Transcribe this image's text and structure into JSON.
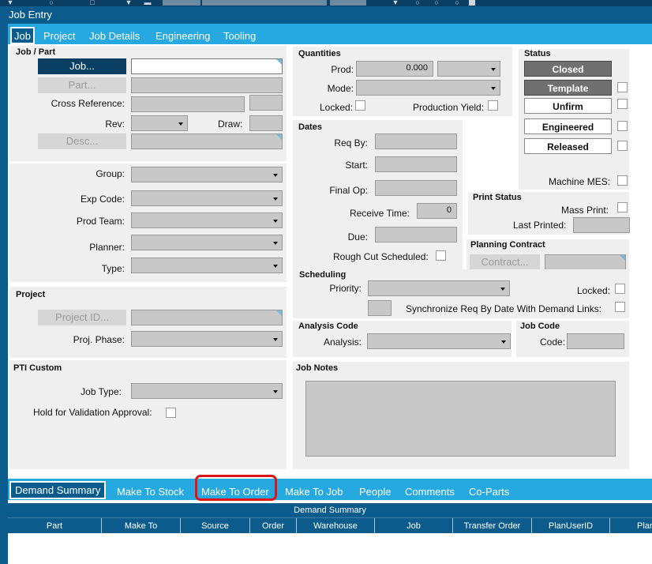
{
  "window": {
    "title": "Job Entry"
  },
  "tabs": [
    "Job",
    "Project",
    "Job Details",
    "Engineering",
    "Tooling"
  ],
  "job_part": {
    "title": "Job / Part",
    "job_button": "Job...",
    "part_button": "Part...",
    "cross_reference_label": "Cross Reference:",
    "rev_label": "Rev:",
    "draw_label": "Draw:",
    "desc_button": "Desc..."
  },
  "classification": {
    "group_label": "Group:",
    "exp_code_label": "Exp Code:",
    "prod_team_label": "Prod Team:",
    "planner_label": "Planner:",
    "type_label": "Type:"
  },
  "project": {
    "title": "Project",
    "project_id_button": "Project ID...",
    "proj_phase_label": "Proj. Phase:"
  },
  "pti_custom": {
    "title": "PTI Custom",
    "job_type_label": "Job Type:",
    "hold_label": "Hold for Validation Approval:"
  },
  "quantities": {
    "title": "Quantities",
    "prod_label": "Prod:",
    "prod_value": "0.000",
    "mode_label": "Mode:",
    "locked_label": "Locked:",
    "production_yield_label": "Production Yield:"
  },
  "dates": {
    "title": "Dates",
    "req_by_label": "Req By:",
    "start_label": "Start:",
    "final_op_label": "Final Op:",
    "receive_time_label": "Receive Time:",
    "receive_time_value": "0",
    "due_label": "Due:",
    "rough_cut_label": "Rough Cut Scheduled:"
  },
  "status": {
    "title": "Status",
    "closed_button": "Closed",
    "template_button": "Template",
    "unfirm_button": "Unfirm",
    "engineered_button": "Engineered",
    "released_button": "Released",
    "machine_mes_label": "Machine MES:"
  },
  "print_status": {
    "title": "Print Status",
    "mass_print_label": "Mass Print:",
    "last_printed_label": "Last Printed:"
  },
  "planning_contract": {
    "title": "Planning Contract",
    "contract_button": "Contract..."
  },
  "scheduling": {
    "title": "Scheduling",
    "priority_label": "Priority:",
    "locked_label": "Locked:",
    "sync_label": "Synchronize Req By Date With Demand Links:"
  },
  "analysis_code": {
    "title": "Analysis Code",
    "analysis_label": "Analysis:"
  },
  "job_code": {
    "title": "Job Code",
    "code_label": "Code:"
  },
  "job_notes": {
    "title": "Job Notes"
  },
  "bottom_tabs": [
    "Demand Summary",
    "Make To Stock",
    "Make To Order",
    "Make To Job",
    "People",
    "Comments",
    "Co-Parts"
  ],
  "grid": {
    "title": "Demand Summary",
    "columns": [
      "Part",
      "Make To",
      "Source",
      "Order",
      "Warehouse",
      "Job",
      "Transfer Order",
      "PlanUserID",
      "Plan"
    ]
  },
  "colors": {
    "tab_bar": "#26a9e0",
    "title_bar": "#0b5c8c",
    "highlight": "#e01414"
  }
}
